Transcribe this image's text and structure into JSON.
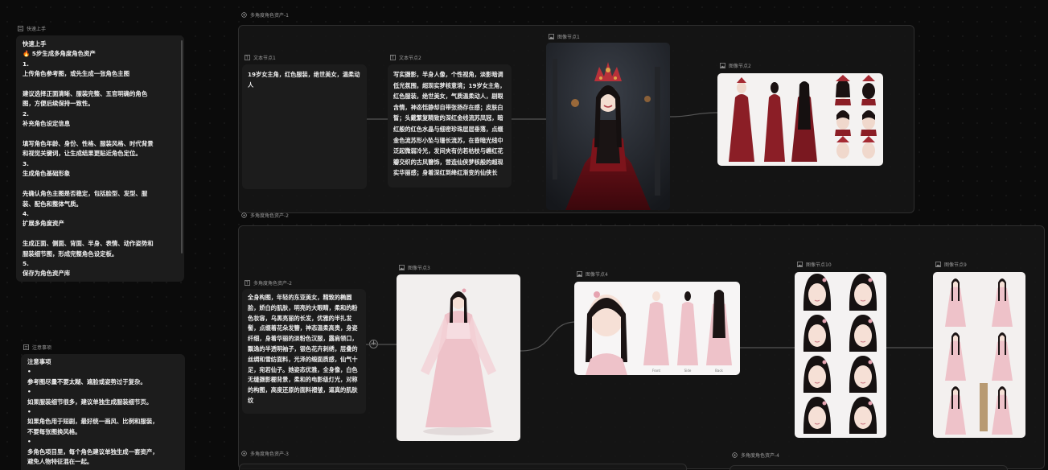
{
  "groups": {
    "g1": "多角度角色资产-1",
    "g2": "多角度角色资产-2",
    "g3": "多角度角色资产-3",
    "g4": "多角度角色资产-4"
  },
  "quickstart": {
    "caption": "快速上手",
    "lines": [
      "快速上手",
      "🔥 5步生成多角度角色资产",
      "1.",
      "上传角色参考图，或先生成一张角色主图",
      "",
      "建议选择正面清晰、服装完整、五官明确的角色",
      "图，方便后续保持一致性。",
      "2.",
      "补充角色设定信息",
      "",
      "填写角色年龄、身份、性格、服装风格、时代背景",
      "和视觉关键词，让生成结果更贴近角色定位。",
      "3.",
      "生成角色基础形象",
      "",
      "先确认角色主图是否稳定，包括脸型、发型、服",
      "装、配色和整体气质。",
      "4.",
      "扩展多角度资产",
      "",
      "生成正面、侧面、背面、半身、表情、动作姿势和",
      "服装细节图，形成完整角色设定板。",
      "5.",
      "保存为角色资产库"
    ]
  },
  "notice": {
    "caption": "注意事项",
    "lines": [
      "注意事项",
      "•",
      "参考图尽量不要太糊、遮脸或姿势过于复杂。",
      "•",
      "如果服装细节很多，建议单独生成服装细节页。",
      "•",
      "如果角色用于短剧，最好统一画风、比例和服装，",
      "不要每张图换风格。",
      "•",
      "多角色项目里，每个角色建议单独生成一套资产，",
      "避免人物特征混在一起。"
    ]
  },
  "nodes": {
    "text1": {
      "caption": "文本节点1",
      "body": "19岁女主角，红色服装，绝世美女，温柔动人"
    },
    "text2": {
      "caption": "文本节点2",
      "body": "写实摄影，半身人像，个性视角，淡影暗调低光氛围，超现实梦核意境；19岁女主角，红色服装，绝世美女，气质温柔动人，剧眼含情，神态恬静却自带张扬存在感；皮肤白皙；头戴繁复精致的深红金线流苏凤冠，暗红般的红色水晶与细密珍珠层层垂落，点缀金色流苏形小坠与珊长流苏，在昏暗光线中泛起微弱冷光，发间夹有仿若枯枝与缠红花瓣交织的古风簪饰，营造仙侠梦核般的超现实华丽感；身着深红到绛红渐变的仙侠长"
    },
    "img1": {
      "caption": "图像节点1"
    },
    "img2": {
      "caption": "图像节点2"
    },
    "text3": {
      "caption": "多角度角色资产-2",
      "body": "全身构图，年轻的东亚美女，精致的椭圆脸，娇白的肌肤，明亮的大眼睛，柔和的粉色妆容，乌黑亮丽的长发，优雅的半扎发髻，点缀着花朵发簪，神态温柔高贵，身姿纤细，身着华丽的淡粉色汉服，露肩领口，飘逸的半透明袖子，银色花卉刺绣，层叠的丝绸和雪纺面料，光泽的缎面质感，仙气十足，宛若仙子。她姿态优雅，全身像，白色无缝摄影棚背景，柔和的电影级灯光，对称的构图，高度还原的面料褶皱，逼真的肌肤纹"
    },
    "img3": {
      "caption": "图像节点3"
    },
    "img4": {
      "caption": "图像节点4",
      "labels": [
        "Front",
        "Side",
        "Back"
      ]
    },
    "img10": {
      "caption": "图像节点10"
    },
    "img9": {
      "caption": "图像节点9"
    }
  },
  "colors": {
    "bg": "#0b0b0b",
    "panel": "#1c1c1c",
    "border": "#2e2e2e",
    "red": "#8a1c22",
    "pink": "#e8b8c0"
  }
}
